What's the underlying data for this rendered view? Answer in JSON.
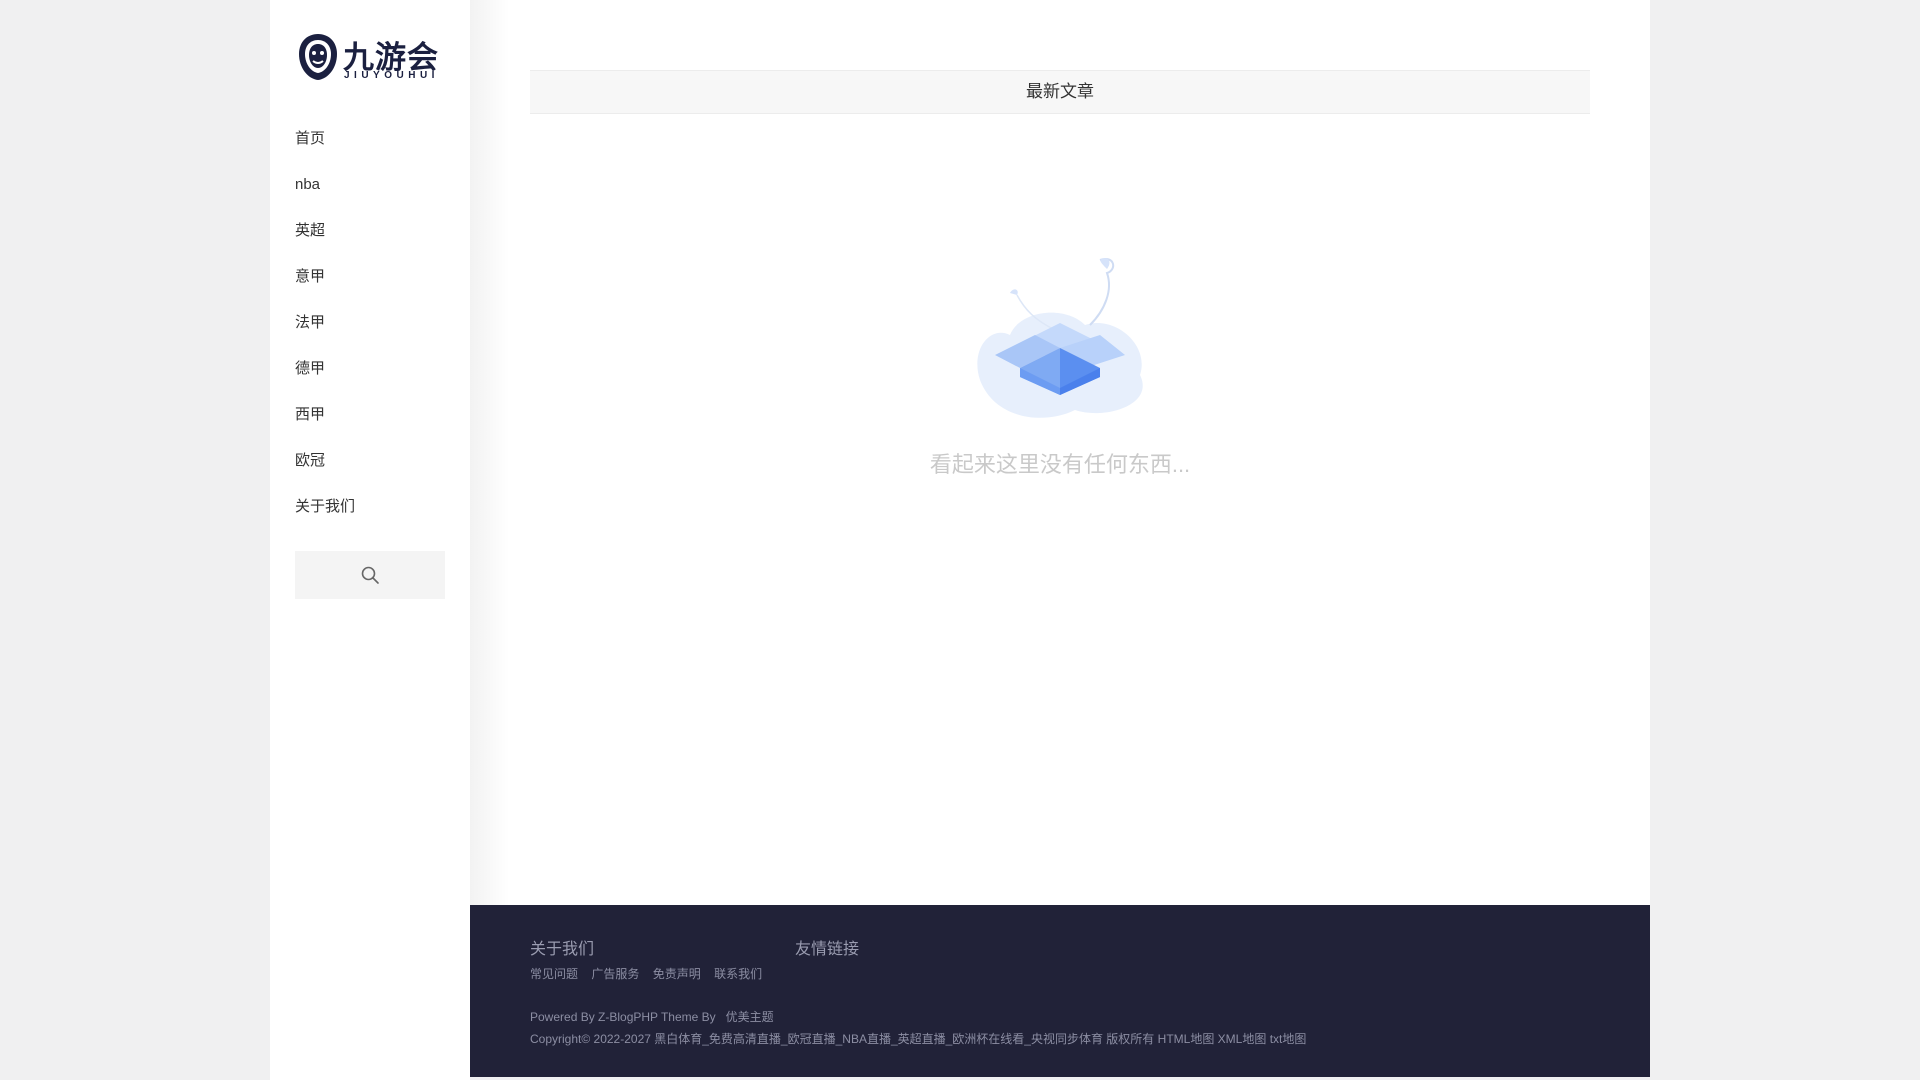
{
  "logo": {
    "cn": "九游会",
    "en": "JIUYOUHUI"
  },
  "nav": {
    "items": [
      {
        "label": "首页"
      },
      {
        "label": "nba"
      },
      {
        "label": "英超"
      },
      {
        "label": "意甲"
      },
      {
        "label": "法甲"
      },
      {
        "label": "德甲"
      },
      {
        "label": "西甲"
      },
      {
        "label": "欧冠"
      },
      {
        "label": "关于我们"
      }
    ]
  },
  "search": {
    "icon": "search-icon"
  },
  "main": {
    "section_title": "最新文章",
    "empty_message": "看起来这里没有任何东西..."
  },
  "footer": {
    "about_title": "关于我们",
    "links_title": "友情链接",
    "about_links": [
      "常见问题",
      "广告服务",
      "免责声明",
      "联系我们"
    ],
    "powered_prefix": "Powered By Z-BlogPHP Theme By",
    "theme_author": "优美主题",
    "copyright": "Copyright© 2022-2027 黑白体育_免费高清直播_欧冠直播_NBA直播_英超直播_欧洲杯在线看_央视同步体育 版权所有",
    "sitemap_html": "HTML地图",
    "sitemap_xml": "XML地图",
    "sitemap_txt": "txt地图"
  },
  "colors": {
    "footer_bg": "#212238",
    "brand": "#1b2040",
    "page_bg": "#f0f0f1"
  }
}
